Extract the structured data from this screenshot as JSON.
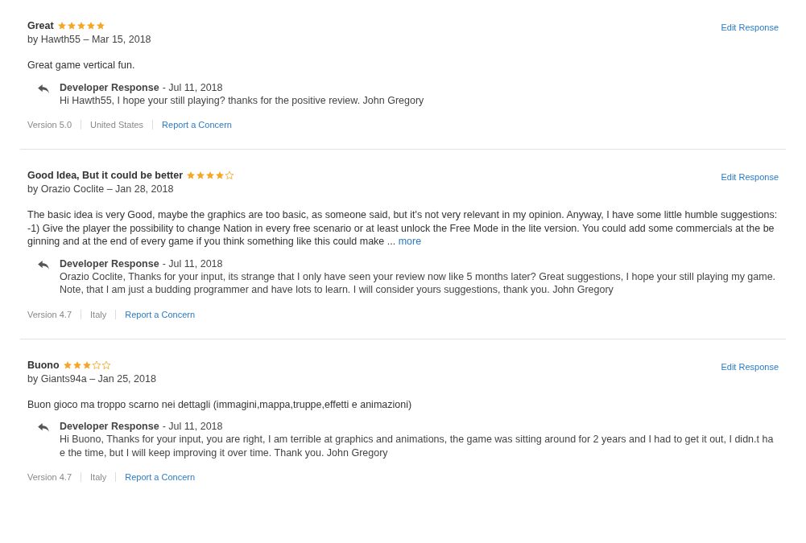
{
  "reviews": [
    {
      "title": "Great",
      "stars": 5,
      "byline": "by Hawth55 – Mar 15, 2018",
      "edit_link": "Edit Response",
      "body": "Great game vertical fun.",
      "response": {
        "heading": "Developer Response",
        "date": "- Jul 11, 2018",
        "text": "Hi Hawth55, I hope your still playing? thanks for the positive review. John Gregory"
      },
      "version": "Version 5.0",
      "country": "United States",
      "report_link": "Report a Concern"
    },
    {
      "title": "Good Idea, But it could be better",
      "stars": 4,
      "byline": "by Orazio Coclite – Jan 28, 2018",
      "edit_link": "Edit Response",
      "body": "The basic idea is very Good, maybe the graphics are too basic, as someone said, but it's not very relevant in my opinion. Anyway, I have some little humble suggestions:\n-1) Give the player the possibility to change Nation in every free scenario or at least unlock the Free Mode in the lite version. You could add some commercials at the beginning and at the end of every game if you think something like this could make ...",
      "more_link": "more",
      "response": {
        "heading": "Developer Response",
        "date": "- Jul 11, 2018",
        "text": "Orazio Coclite, Thanks for your input, its strange that I only have seen your review now like 5 months later? Great suggestions, I hope your still playing my game. Note, that I am just a budding programmer and have lots to learn. I will consider yours suggestions, thank you. John Gregory"
      },
      "version": "Version 4.7",
      "country": "Italy",
      "report_link": "Report a Concern"
    },
    {
      "title": "Buono",
      "stars": 3,
      "byline": "by Giants94a – Jan 25, 2018",
      "edit_link": "Edit Response",
      "body": "Buon gioco ma troppo scarno nei dettagli (immagini,mappa,truppe,effetti e animazioni)",
      "response": {
        "heading": "Developer Response",
        "date": "- Jul 11, 2018",
        "text": "Hi Buono, Thanks for your input, you are right, I am terrible at graphics and animations, the game was sitting around for 2 years and I had to get it out, I didn.t hae the time, but I will keep improving it over time. Thank you. John Gregory"
      },
      "version": "Version 4.7",
      "country": "Italy",
      "report_link": "Report a Concern"
    }
  ]
}
